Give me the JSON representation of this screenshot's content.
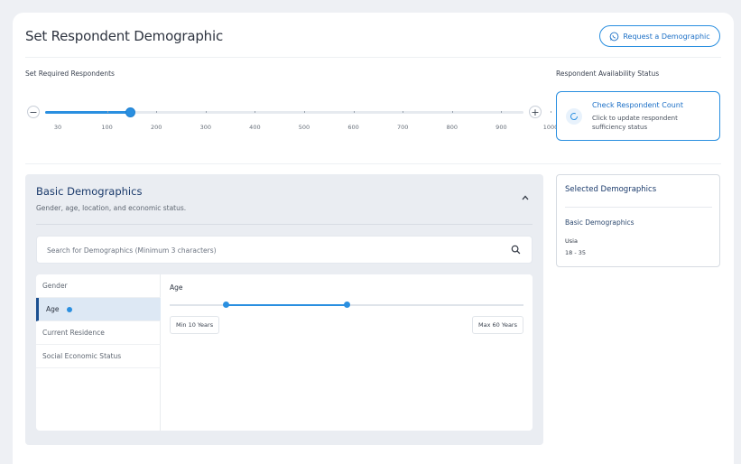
{
  "header": {
    "title": "Set Respondent Demographic",
    "request_button": "Request a Demographic"
  },
  "respondents": {
    "label": "Set Required Respondents",
    "minus": "−",
    "plus": "+",
    "ticks": [
      "30",
      "100",
      "200",
      "300",
      "400",
      "500",
      "600",
      "700",
      "800",
      "900",
      "1000"
    ],
    "selected_value": 200
  },
  "availability": {
    "label": "Respondent Availability Status",
    "card_title": "Check Respondent Count",
    "card_subtitle": "Click to update respondent sufficiency status"
  },
  "basic": {
    "title": "Basic Demographics",
    "subtitle": "Gender, age, location, and economic status.",
    "search_placeholder": "Search for Demographics (Minimum 3 characters)",
    "categories": [
      "Gender",
      "Age",
      "Current Residence",
      "Social Economic Status"
    ],
    "active_category": "Age",
    "age": {
      "label": "Age",
      "min_label": "Min 10 Years",
      "max_label": "Max 60 Years",
      "range_min": 10,
      "range_max": 60,
      "selected_min": 18,
      "selected_max": 35
    }
  },
  "selected": {
    "title": "Selected Demographics",
    "group": "Basic Demographics",
    "key": "Usia",
    "value": "18 - 35"
  },
  "colors": {
    "accent": "#2a8fe0",
    "heading": "#1a3a6b"
  }
}
